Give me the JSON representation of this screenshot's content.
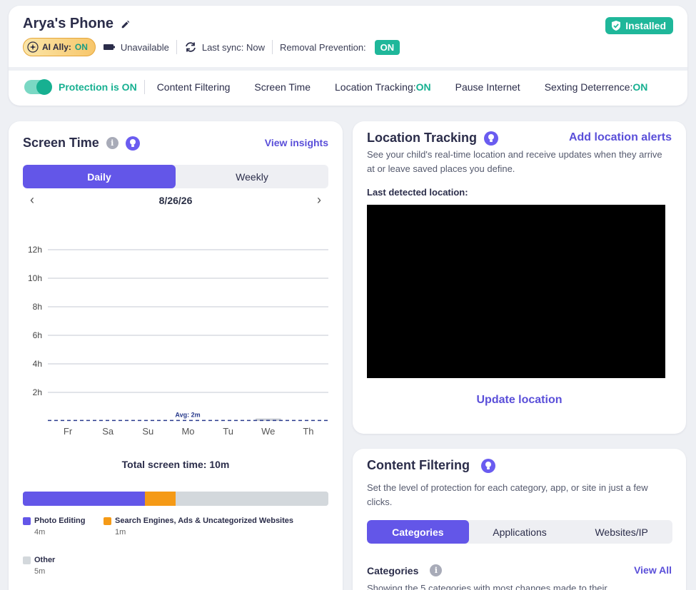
{
  "header": {
    "device_name": "Arya's Phone",
    "installed_label": "Installed",
    "ai_ally_label": "AI Ally:",
    "ai_ally_value": "ON",
    "battery_status": "Unavailable",
    "last_sync": "Last sync: Now",
    "removal_prevention_label": "Removal Prevention:",
    "removal_prevention_value": "ON",
    "protection_label": "Protection is ON",
    "nav": {
      "content_filtering": "Content Filtering",
      "screen_time": "Screen Time",
      "location_tracking_label": "Location Tracking:",
      "location_tracking_value": "ON",
      "pause_internet": "Pause Internet",
      "sexting_label": "Sexting Deterrence:",
      "sexting_value": "ON"
    }
  },
  "screen_time": {
    "title": "Screen Time",
    "view_insights": "View insights",
    "tabs": [
      "Daily",
      "Weekly"
    ],
    "active_tab": "Daily",
    "date": "8/26/26",
    "total_label": "Total screen time: 10m",
    "usage": [
      {
        "name": "Photo Editing",
        "value": "4m",
        "minutes": 4,
        "color": "#6356e8"
      },
      {
        "name": "Search Engines, Ads & Uncategorized Websites",
        "value": "1m",
        "minutes": 1,
        "color": "#f59a16"
      },
      {
        "name": "Other",
        "value": "5m",
        "minutes": 5,
        "color": "#d3d8dc"
      }
    ]
  },
  "chart_data": {
    "type": "bar",
    "categories": [
      "Fr",
      "Sa",
      "Su",
      "Mo",
      "Tu",
      "We",
      "Th"
    ],
    "values": [
      0,
      0,
      0,
      0,
      0,
      0.17,
      0
    ],
    "ylim": [
      0,
      12
    ],
    "yticks": [
      "2h",
      "4h",
      "6h",
      "8h",
      "10h",
      "12h"
    ],
    "average_label": "Avg: 2m",
    "average_value": 0.033,
    "grid": true,
    "title": "",
    "xlabel": "",
    "ylabel": ""
  },
  "location": {
    "title": "Location Tracking",
    "add_alerts": "Add location alerts",
    "description": "See your child's real-time location and receive updates when they arrive at or leave saved places you define.",
    "last_detected": "Last detected location:",
    "update_button": "Update location"
  },
  "content_filtering": {
    "title": "Content Filtering",
    "description": "Set the level of protection for each category, app, or site in just a few clicks.",
    "tabs": [
      "Categories",
      "Applications",
      "Websites/IP"
    ],
    "active_tab": "Categories",
    "categories_heading": "Categories",
    "view_all": "View All",
    "cut_text": "Showing the 5 categories with most changes made to their"
  }
}
